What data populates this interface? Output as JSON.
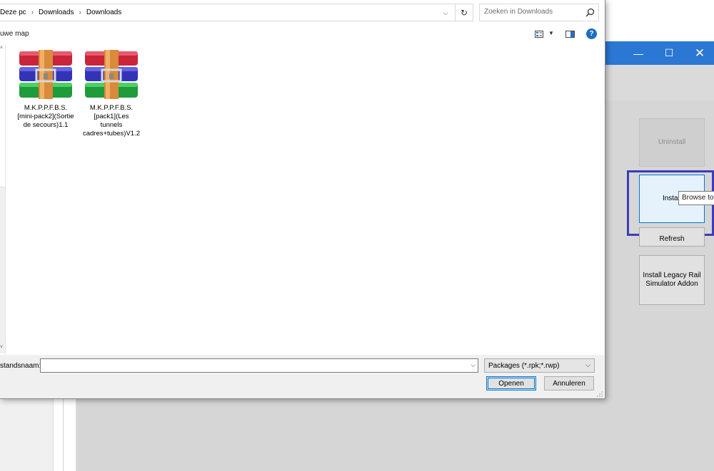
{
  "dialog": {
    "breadcrumb": [
      "Deze pc",
      "Downloads",
      "Downloads"
    ],
    "search": {
      "placeholder": "Zoeken in Downloads"
    },
    "toolbar": {
      "new_folder": "uwe map"
    },
    "files": [
      {
        "name": "M.K.P.P.F.B.S.[mini-pack2](Sortie de secours)1.1",
        "icon": "winrar-archive-icon"
      },
      {
        "name": "M.K.P.P.F.B.S.[pack1](Les tunnels cadres+tubes)V1.2",
        "icon": "winrar-archive-icon"
      }
    ],
    "filename_label": "standsnaam:",
    "filename_value": "",
    "filetype": "Packages (*.rpk;*.rwp)",
    "open_label": "Openen",
    "cancel_label": "Annuleren"
  },
  "app": {
    "window_controls": {
      "minimize": "—",
      "maximize": "☐",
      "close": "✕"
    },
    "buttons": {
      "uninstall": "Uninstall",
      "install": "Install",
      "refresh": "Refresh",
      "legacy": "Install Legacy Rail Simulator Addon"
    },
    "tooltip": "Browse to"
  },
  "colors": {
    "titlebar": "#2b78d4",
    "focus_ring": "#3c3cb8",
    "accent": "#0078d7"
  }
}
